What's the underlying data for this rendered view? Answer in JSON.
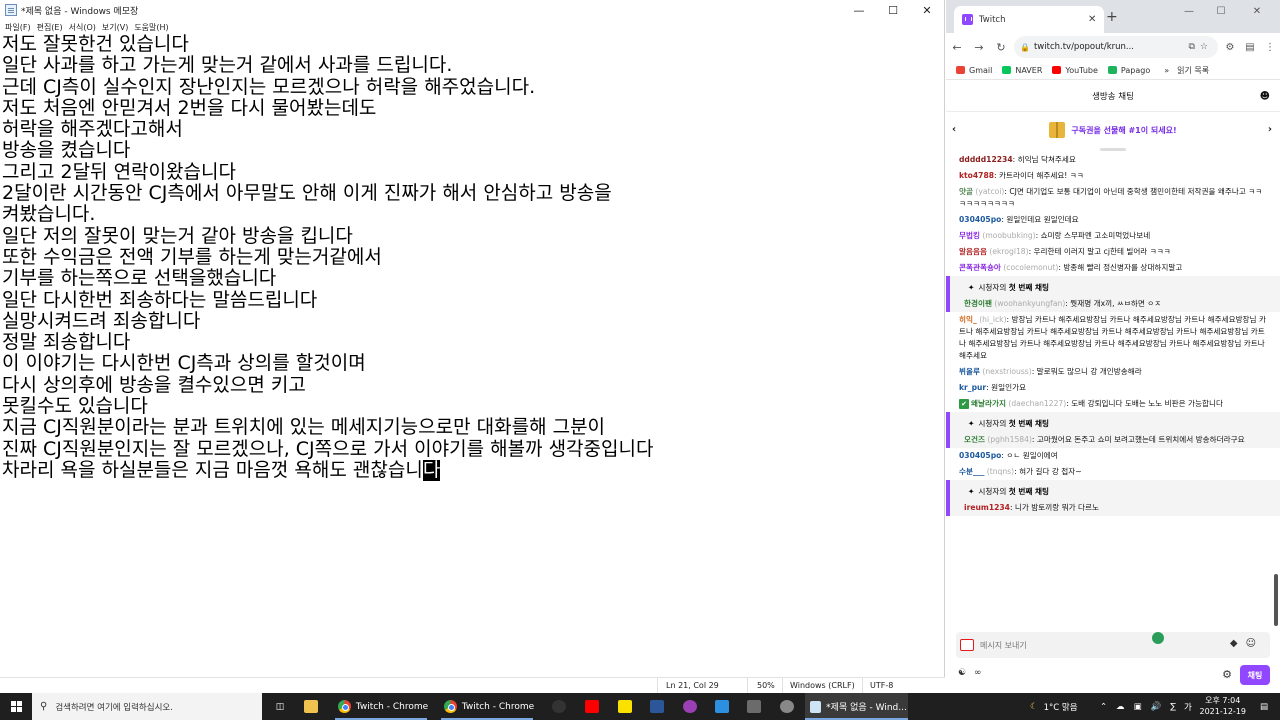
{
  "notepad": {
    "title": "*제목 없음 - Windows 메모장",
    "menu": [
      "파일(F)",
      "편집(E)",
      "서식(O)",
      "보기(V)",
      "도움말(H)"
    ],
    "lines": [
      "저도 잘못한건 있습니다",
      "일단 사과를 하고 가는게 맞는거 같에서 사과를 드립니다.",
      "근데 CJ측이 실수인지 장난인지는 모르겠으나 허락을 해주었습니다.",
      "저도 처음엔 안믿겨서 2번을 다시 물어봤는데도",
      "허락을 해주겠다고해서",
      "방송을 켰습니다",
      "그리고 2달뒤 연락이왔습니다",
      "2달이란 시간동안 CJ측에서 아무말도 안해 이게 진짜가 해서 안심하고 방송을",
      "켜봤습니다.",
      "일단 저의 잘못이 맞는거 같아 방송을 킵니다",
      "또한 수익금은 전액 기부를 하는게 맞는거같에서",
      "기부를 하는쪽으로 선택을했습니다",
      "일단 다시한번 죄송하다는 말씀드립니다",
      "실망시켜드려 죄송합니다",
      "정말 죄송합니다",
      "이 이야기는 다시한번 CJ측과 상의를 할것이며",
      "다시 상의후에 방송을 켤수있으면 키고",
      "못킬수도 있습니다",
      "지금 CJ직원분이라는 분과 트위치에 있는 메세지기능으로만 대화를해 그분이",
      "진짜 CJ직원분인지는 잘 모르겠으나, CJ쪽으로 가서 이야기를 해볼까 생각중입니다"
    ],
    "last_line": "차라리 욕을 하실분들은 지금 마음껏 욕해도 괜찮습니",
    "last_char": "다",
    "status": {
      "position": "Ln 21, Col 29",
      "zoom": "50%",
      "eol": "Windows (CRLF)",
      "encoding": "UTF-8"
    }
  },
  "chrome": {
    "tab_title": "Twitch",
    "url": "twitch.tv/popout/krun...",
    "bookmarks": [
      "Gmail",
      "NAVER",
      "YouTube",
      "Papago"
    ],
    "reading_list": "읽기 목록",
    "chat_header": "생방송 채팅",
    "sub_banner": "구독권을 선물해 #1이 되세요!",
    "first_chat_label": "시청자의",
    "first_chat_bold": "첫 번째 채팅",
    "messages": [
      {
        "name": "ddddd12234",
        "id": "",
        "color": "#8a1e1e",
        "text": ": 히익님 닥쳐주세요",
        "first": false
      },
      {
        "name": "kto4788",
        "id": "",
        "color": "#b22222",
        "text": ": 카트라이더 해주세요! ㅋㅋ",
        "first": false
      },
      {
        "name": "얏골",
        "id": "(yatcoi)",
        "color": "#5b8c5b",
        "text": ": CJ면 대기업도 보통 대기업이 아닌데 중학생 잼민이한테 저작권을 왜주나고 ㅋㅋㅋㅋㅋㅋㅋㅋㅋㅋ",
        "first": false
      },
      {
        "name": "030405po",
        "id": "",
        "color": "#1e5aa0",
        "text": ": 원일인데요 원일인데요",
        "first": false
      },
      {
        "name": "무법킹",
        "id": "(moobubking)",
        "color": "#8a2be2",
        "text": ": 쇼미랑 스무파멘 고소미먹었나보네",
        "first": false
      },
      {
        "name": "알음음음",
        "id": "(ekrogl18)",
        "color": "#b22222",
        "text": ": 우리한테 이러지 말고 cj한테 빌어라 ㅋㅋㅋ",
        "first": false
      },
      {
        "name": "콘폭관폭숑아",
        "id": "(cocolemonut)",
        "color": "#8a2be2",
        "text": ": 방종해 빨리 정신병자를 상대하지말고",
        "first": false
      },
      {
        "name": "한경이팬",
        "id": "(woohankyungfan)",
        "color": "#2e7d32",
        "text": ": 뭣재명 개x끼, ㅆㅂ하면 ㅇㅈ",
        "first": true
      },
      {
        "name": "히익_",
        "id": "(hi_ick)",
        "color": "#d2691e",
        "text": ": 방장님 카트나 해주세요방장님 카트나 해주세요방장님 카트나 해주세요방장님 카트나 해주세요방장님 카트나 해주세요방장님 카트나 해주세요방장님 카트나 해주세요방장님 카트나 해주세요방장님 카트나 해주세요방장님 카트나 해주세요방장님 카트나 해주세요방장님 카트나 해주세요",
        "first": false
      },
      {
        "name": "뷔올루",
        "id": "(nexstriouss)",
        "color": "#1e5aa0",
        "text": ": 말로뭐도 많으니 강 개인방송해라",
        "first": false
      },
      {
        "name": "kr_pur",
        "id": "",
        "color": "#1e5aa0",
        "text": ": 원일인가요",
        "first": false
      },
      {
        "name": "왜날라가지",
        "id": "(daechan1227)",
        "color": "#2e7d32",
        "text": ": 도배 강퇴입니다 도배는 노노 비판은 가능합니다",
        "first": false,
        "badge": true
      },
      {
        "name": "오건즈",
        "id": "(pghh1584)",
        "color": "#2e7d32",
        "text": ": 고마웠어요 돈주고 쇼미 보려고했는데 트위치에서 방송하더라구요",
        "first": true
      },
      {
        "name": "030405po",
        "id": "",
        "color": "#1e5aa0",
        "text": ": ㅇㄴ 원일이에여",
        "first": false
      },
      {
        "name": "수분___",
        "id": "(tnqns)",
        "color": "#1e5aa0",
        "text": ": 혀가 길다 강 접자~",
        "first": false
      },
      {
        "name": "ireum1234",
        "id": "",
        "color": "#b22222",
        "text": ": 니가 밤토끼랑 뭐가 다르노",
        "first": true
      }
    ],
    "input_placeholder": "메시지 보내기",
    "chat_button": "채팅",
    "infinity": "∞"
  },
  "taskbar": {
    "search_placeholder": "검색하려면 여기에 입력하십시오.",
    "chrome1": "Twitch - Chrome",
    "chrome2": "Twitch - Chrome",
    "notepad_app": "*제목 없음 - Wind...",
    "weather": "1°C 맑음",
    "ime": "가",
    "time": "오후 7:04",
    "date": "2021-12-19"
  }
}
